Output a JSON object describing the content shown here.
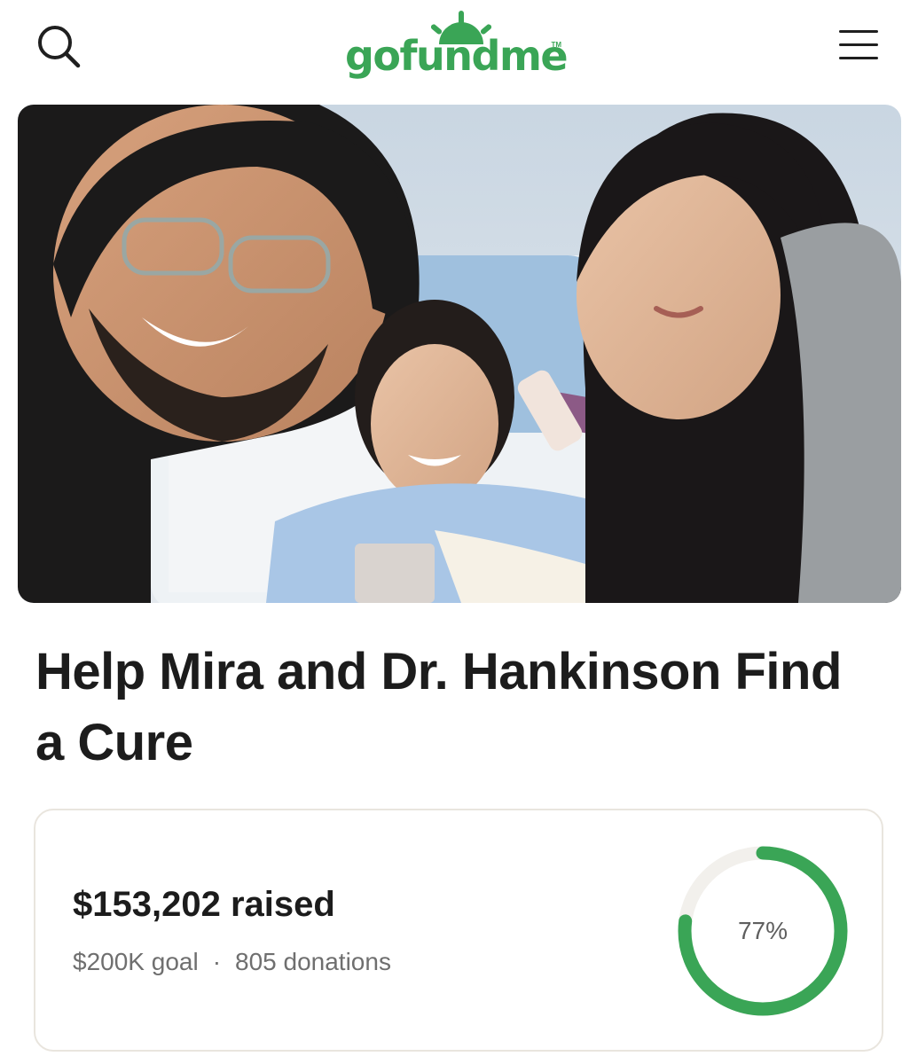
{
  "header": {
    "logo_text": "gofundme",
    "logo_tm": "TM",
    "search_icon": "search-icon",
    "menu_icon": "hamburger-menu-icon",
    "brand_color": "#3aa556"
  },
  "campaign": {
    "title": "Help Mira and Dr. Hankinson Find a Cure",
    "raised_text": "$153,202 raised",
    "goal_text": "$200K goal",
    "separator": "·",
    "donations_text": "805 donations",
    "progress_percent": 77,
    "progress_label": "77%",
    "progress_color": "#3aa556",
    "progress_track_color": "#f2f0ec"
  }
}
